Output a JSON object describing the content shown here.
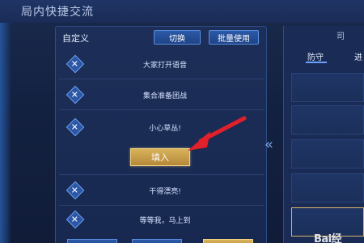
{
  "window": {
    "title": "局内快捷交流"
  },
  "panel": {
    "label": "自定义",
    "switch_button": "切换",
    "batch_button": "批量使用",
    "rows": [
      {
        "text": "大家打开语音"
      },
      {
        "text": "集合准备团战"
      },
      {
        "text": "小心草丛!"
      },
      {
        "text": "干得漂亮!"
      },
      {
        "text": "等等我，马上到"
      }
    ],
    "fill_button": "填入",
    "row_icon": "close-icon"
  },
  "nav": {
    "chevrons": "«"
  },
  "right_panel": {
    "top_char": "司",
    "tabs": [
      {
        "label": "防守"
      },
      {
        "label": "进"
      }
    ]
  },
  "watermark": "Bai经",
  "colors": {
    "accent_blue": "#2c5aa8",
    "accent_gold": "#d8b35a",
    "annotation_red": "#e0202a"
  }
}
